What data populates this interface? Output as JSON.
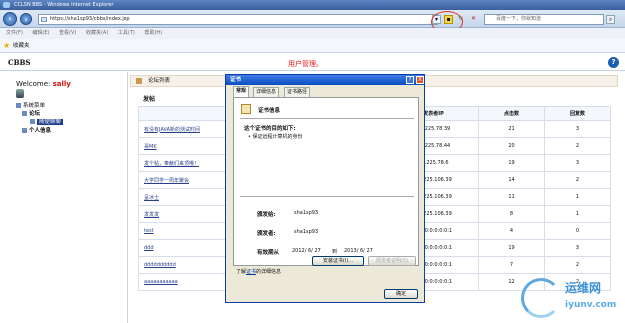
{
  "window": {
    "title": "CCLSN BBS - Windows Internet Explorer"
  },
  "browser": {
    "url": "https://sha1sp93/cbbs/index.jsp",
    "search_placeholder": "百度一下，你就知道",
    "menu": [
      "文件(F)",
      "编辑(E)",
      "查看(V)",
      "收藏夹(A)",
      "工具(T)",
      "帮助(H)"
    ],
    "favorites_label": "收藏夹"
  },
  "header": {
    "title": "CBBS",
    "user_mgmt": "用户管理。",
    "help": "?"
  },
  "sidebar": {
    "welcome": "Welcome: ",
    "username": "sally",
    "tree": [
      "系统菜单",
      "论坛",
      "随便聊聊",
      "个人信息"
    ]
  },
  "content": {
    "list_title": "论坛列表",
    "section_label": "发帖",
    "columns": [
      "标题",
      "发表者IP",
      "点击数",
      "回复数"
    ],
    "rows": [
      [
        "有没有JAVA新的测试时间",
        "10.225.78.39",
        "21",
        "3"
      ],
      [
        "哥MK",
        "10.225.78.44",
        "20",
        "2"
      ],
      [
        "发个帖，奉献们来顶哦！",
        "10.225.78.6",
        "19",
        "3"
      ],
      [
        "大学同学一周年聚会",
        "10.225.106.39",
        "14",
        "2"
      ],
      [
        "呈冰士",
        "10.225.106.39",
        "11",
        "1"
      ],
      [
        "发发发",
        "10.225.106.39",
        "8",
        "1"
      ],
      [
        "test",
        "0:0:0:0:0:0:0:1",
        "4",
        "0"
      ],
      [
        "ddd",
        "0:0:0:0:0:0:0:1",
        "19",
        "3"
      ],
      [
        "dddddddddd",
        "0:0:0:0:0:0:0:1",
        "7",
        "2"
      ],
      [
        "aaaaaaaaaaa",
        "0:0:0:0:0:0:0:1",
        "12",
        "2"
      ]
    ]
  },
  "dialog": {
    "title": "证书",
    "tabs": [
      "常规",
      "详细信息",
      "证书路径"
    ],
    "info_title": "证书信息",
    "purpose_heading": "这个证书的目的如下:",
    "purpose_item": "• 保证远程计算机的身份",
    "issued_to_label": "颁发给:",
    "issued_to": "sha1sp93",
    "issued_by_label": "颁发者:",
    "issued_by": "sha1sp93",
    "validity_label": "有效期从",
    "validity_from": "2012/ 6/ 27",
    "validity_to_word": "到",
    "validity_to": "2013/ 6/ 27",
    "install_button": "安装证书(I)...",
    "issuer_statement_button": "颁发者说明(S)",
    "learn_more_prefix": "了解",
    "learn_more_link": "证书",
    "learn_more_suffix": "的详细信息",
    "ok_button": "确定",
    "help": "?",
    "close": "X"
  },
  "watermark": {
    "top": "运维网",
    "bottom": "iyunv.com"
  }
}
